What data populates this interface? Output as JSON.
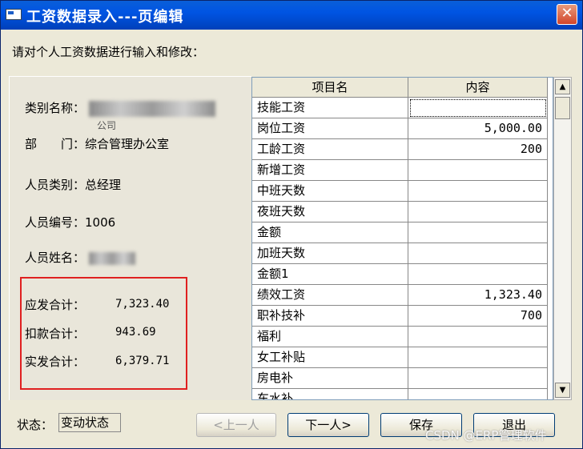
{
  "window": {
    "title": "工资数据录入---页编辑",
    "close_symbol": "✕"
  },
  "instruction": "请对个人工资数据进行输入和修改：",
  "info": {
    "category_label": "类别名称：",
    "category_suffix": "公司",
    "department_label": "部　　门：",
    "department_value": "综合管理办公室",
    "staff_type_label": "人员类别：",
    "staff_type_value": "总经理",
    "staff_id_label": "人员编号：",
    "staff_id_value": "1006",
    "staff_name_label": "人员姓名："
  },
  "totals": {
    "gross_label": "应发合计：",
    "gross_value": "7,323.40",
    "deduction_label": "扣款合计：",
    "deduction_value": "943.69",
    "net_label": "实发合计：",
    "net_value": "6,379.71"
  },
  "grid": {
    "headers": [
      "项目名",
      "内容"
    ],
    "rows": [
      {
        "name": "技能工资",
        "value": ""
      },
      {
        "name": "岗位工资",
        "value": "5,000.00"
      },
      {
        "name": "工龄工资",
        "value": "200"
      },
      {
        "name": "新增工资",
        "value": ""
      },
      {
        "name": "中班天数",
        "value": ""
      },
      {
        "name": "夜班天数",
        "value": ""
      },
      {
        "name": "金额",
        "value": ""
      },
      {
        "name": "加班天数",
        "value": ""
      },
      {
        "name": "金额1",
        "value": ""
      },
      {
        "name": "绩效工资",
        "value": "1,323.40"
      },
      {
        "name": "职补技补",
        "value": "700"
      },
      {
        "name": "福利",
        "value": ""
      },
      {
        "name": "女工补贴",
        "value": ""
      },
      {
        "name": "房电补",
        "value": ""
      },
      {
        "name": "车水补",
        "value": ""
      }
    ]
  },
  "status": {
    "label": "状态：",
    "value": "变动状态"
  },
  "buttons": {
    "prev": "<上一人",
    "next": "下一人>",
    "save": "保存",
    "exit": "退出"
  },
  "watermark": "CSDN @ERP管理软件"
}
